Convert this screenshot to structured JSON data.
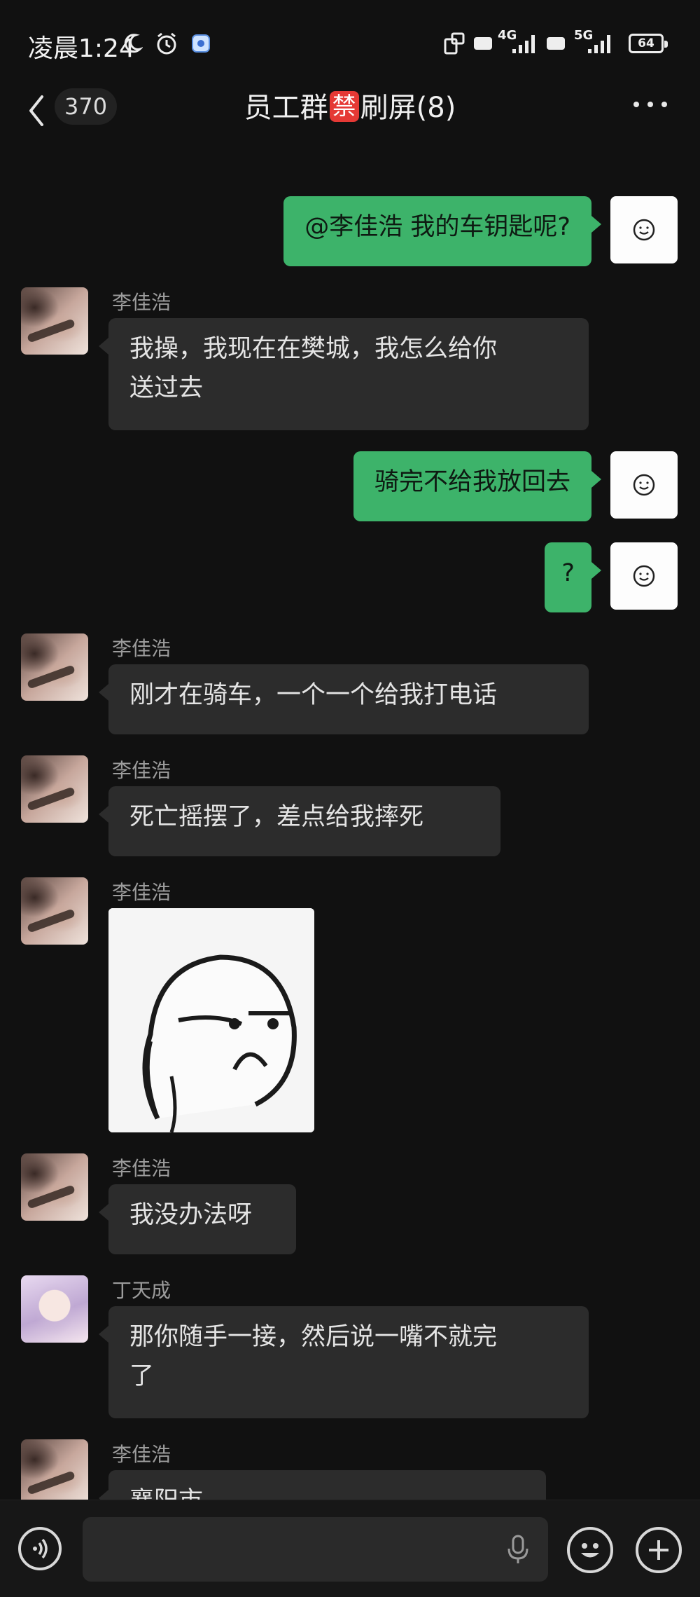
{
  "status_bar": {
    "time": "凌晨1:24",
    "network_1": "4G",
    "network_2": "5G",
    "hd": "HD",
    "battery": "64"
  },
  "header": {
    "unread_count": "370",
    "title_prefix": "员工群",
    "title_emoji": "禁",
    "title_suffix": "刷屏(8)"
  },
  "messages": [
    {
      "side": "out",
      "text": "@李佳浩  我的车钥匙呢?"
    },
    {
      "side": "in",
      "sender": "李佳浩",
      "line1": "我操，我现在在樊城，我怎么给你",
      "line2": "送过去"
    },
    {
      "side": "out",
      "text": "骑完不给我放回去"
    },
    {
      "side": "out",
      "text": "?"
    },
    {
      "side": "in",
      "sender": "李佳浩",
      "text": "刚才在骑车，一个一个给我打电话"
    },
    {
      "side": "in",
      "sender": "李佳浩",
      "text": "死亡摇摆了，差点给我摔死"
    },
    {
      "side": "in",
      "sender": "李佳浩",
      "type": "sticker"
    },
    {
      "side": "in",
      "sender": "李佳浩",
      "text": "我没办法呀"
    },
    {
      "side": "in",
      "sender": "丁天成",
      "line1": "那你随手一接，然后说一嘴不就完",
      "line2": "了"
    },
    {
      "side": "in",
      "sender": "李佳浩",
      "text": "襄阳市……"
    }
  ],
  "input": {
    "placeholder": ""
  },
  "colors": {
    "background": "#111111",
    "outgoing_bubble": "#3db36a",
    "incoming_bubble": "#2c2c2c"
  },
  "icons": [
    "back-chevron-icon",
    "more-icon",
    "voice-icon",
    "mic-icon",
    "emoji-icon",
    "plus-icon"
  ]
}
